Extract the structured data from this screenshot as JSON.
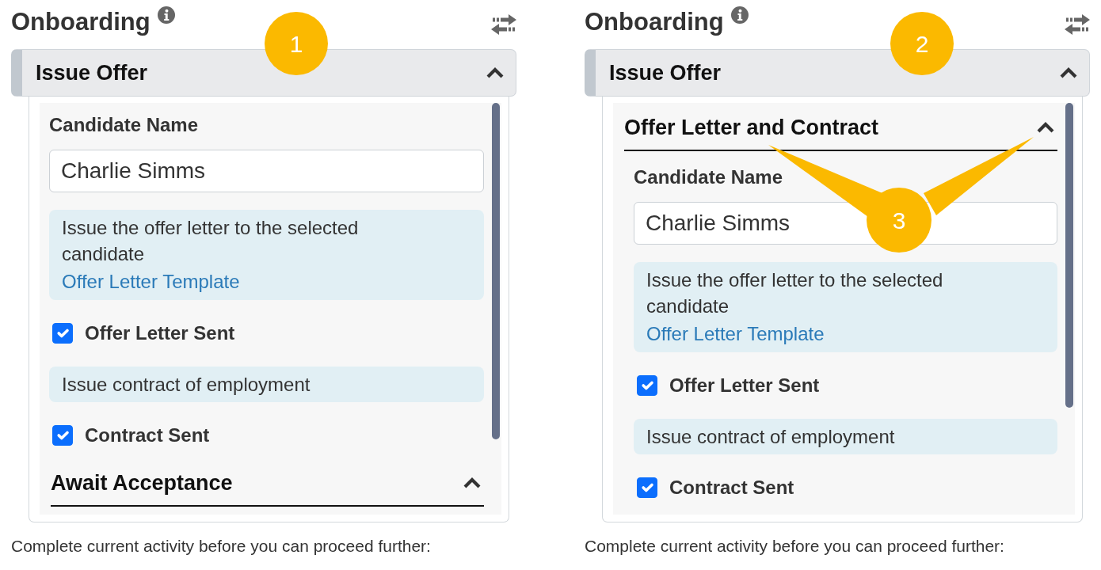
{
  "panels": [
    {
      "title": "Onboarding",
      "accordion": {
        "title": "Issue Offer",
        "expanded": true,
        "callout": "1",
        "items": [
          {
            "kind": "field",
            "label": "Candidate Name",
            "value": "Charlie Simms"
          },
          {
            "kind": "info",
            "text": "Issue the offer letter to the selected candidate",
            "link": "Offer Letter Template"
          },
          {
            "kind": "checkbox",
            "label": "Offer Letter Sent",
            "checked": true
          },
          {
            "kind": "info",
            "text": "Issue contract of employment"
          },
          {
            "kind": "checkbox",
            "label": "Contract Sent",
            "checked": true
          },
          {
            "kind": "section",
            "title": "Await Acceptance",
            "expanded": true
          }
        ]
      },
      "footer": "Complete current activity before you can proceed further:"
    },
    {
      "title": "Onboarding",
      "accordion": {
        "title": "Issue Offer",
        "expanded": true,
        "callout": "2",
        "items": [
          {
            "kind": "section",
            "title": "Offer Letter and Contract",
            "expanded": true,
            "callout": "3",
            "children": [
              {
                "kind": "field",
                "label": "Candidate Name",
                "value": "Charlie Simms"
              },
              {
                "kind": "info",
                "text": "Issue the offer letter to the selected candidate",
                "link": "Offer Letter Template"
              },
              {
                "kind": "checkbox",
                "label": "Offer Letter Sent",
                "checked": true
              },
              {
                "kind": "info",
                "text": "Issue contract of employment"
              },
              {
                "kind": "checkbox",
                "label": "Contract Sent",
                "checked": true
              }
            ]
          }
        ]
      },
      "footer": "Complete current activity before you can proceed further:"
    }
  ]
}
